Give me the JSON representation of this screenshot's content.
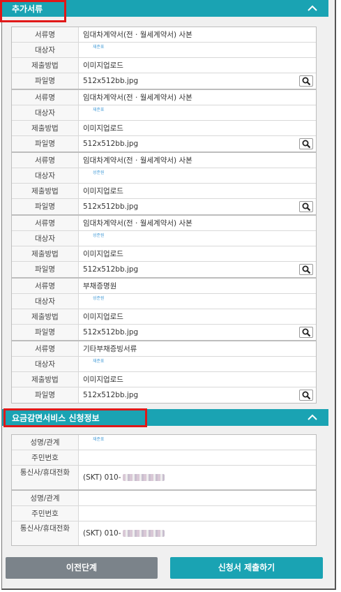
{
  "section1": {
    "title": "추가서류"
  },
  "docs": [
    {
      "doc_label": "서류명",
      "doc_value": "임대차계약서(전 · 월세계약서) 사본",
      "target_label": "대상자",
      "target_value": "재준표",
      "method_label": "제출방법",
      "method_value": "이미지업로드",
      "file_label": "파일명",
      "file_value": "512x512bb.jpg"
    },
    {
      "doc_label": "서류명",
      "doc_value": "임대차계약서(전 · 월세계약서) 사본",
      "target_label": "대상자",
      "target_value": "재준표",
      "method_label": "제출방법",
      "method_value": "이미지업로드",
      "file_label": "파일명",
      "file_value": "512x512bb.jpg"
    },
    {
      "doc_label": "서류명",
      "doc_value": "임대차계약서(전 · 월세계약서) 사본",
      "target_label": "대상자",
      "target_value": "성준원",
      "method_label": "제출방법",
      "method_value": "이미지업로드",
      "file_label": "파일명",
      "file_value": "512x512bb.jpg"
    },
    {
      "doc_label": "서류명",
      "doc_value": "임대차계약서(전 · 월세계약서) 사본",
      "target_label": "대상자",
      "target_value": "성준원",
      "method_label": "제출방법",
      "method_value": "이미지업로드",
      "file_label": "파일명",
      "file_value": "512x512bb.jpg"
    },
    {
      "doc_label": "서류명",
      "doc_value": "부채증명원",
      "target_label": "대상자",
      "target_value": "성준원",
      "method_label": "제출방법",
      "method_value": "이미지업로드",
      "file_label": "파일명",
      "file_value": "512x512bb.jpg"
    },
    {
      "doc_label": "서류명",
      "doc_value": "기타부채증빙서류",
      "target_label": "대상자",
      "target_value": "재준표",
      "method_label": "제출방법",
      "method_value": "이미지업로드",
      "file_label": "파일명",
      "file_value": "512x512bb.jpg"
    }
  ],
  "section2": {
    "title": "요금감면서비스 신청정보"
  },
  "applicants": [
    {
      "name_label": "성명/관계",
      "name_value": "재준표",
      "id_label": "주민번호",
      "id_value": "",
      "carrier_label": "통신사/휴대전화",
      "carrier_value": "(SKT) 010-"
    },
    {
      "name_label": "성명/관계",
      "name_value": "",
      "id_label": "주민번호",
      "id_value": "",
      "carrier_label": "통신사/휴대전화",
      "carrier_value": "(SKT) 010-"
    }
  ],
  "buttons": {
    "prev": "이전단계",
    "submit": "신청서 제출하기"
  }
}
